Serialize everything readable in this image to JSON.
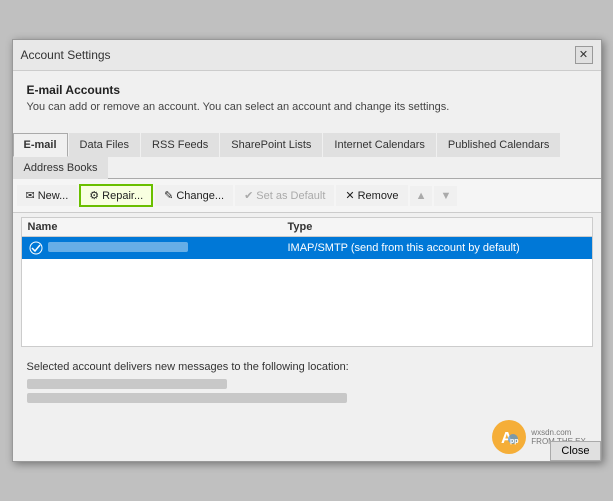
{
  "window": {
    "title": "Account Settings",
    "close_label": "✕"
  },
  "header": {
    "section_title": "E-mail Accounts",
    "section_desc": "You can add or remove an account. You can select an account and change its settings."
  },
  "tabs": [
    {
      "id": "email",
      "label": "E-mail",
      "active": true
    },
    {
      "id": "data-files",
      "label": "Data Files",
      "active": false
    },
    {
      "id": "rss-feeds",
      "label": "RSS Feeds",
      "active": false
    },
    {
      "id": "sharepoint",
      "label": "SharePoint Lists",
      "active": false
    },
    {
      "id": "internet-cal",
      "label": "Internet Calendars",
      "active": false
    },
    {
      "id": "published-cal",
      "label": "Published Calendars",
      "active": false
    },
    {
      "id": "address-books",
      "label": "Address Books",
      "active": false
    }
  ],
  "toolbar": {
    "new_label": "New...",
    "repair_label": "Repair...",
    "change_label": "Change...",
    "set_default_label": "Set as Default",
    "remove_label": "Remove",
    "up_label": "▲",
    "down_label": "▼"
  },
  "table": {
    "col_name": "Name",
    "col_type": "Type",
    "rows": [
      {
        "name": "account_name_blurred",
        "type": "IMAP/SMTP (send from this account by default)",
        "selected": true,
        "has_check": true
      }
    ]
  },
  "bottom": {
    "delivers_label": "Selected account delivers new messages to the following location:",
    "location_line1": "blurred_location_line1",
    "location_line2": "blurred_location_line2"
  },
  "watermark": {
    "site": "wxsdn.com",
    "tagline": "FROM THE EX...",
    "close_btn": "Close"
  }
}
